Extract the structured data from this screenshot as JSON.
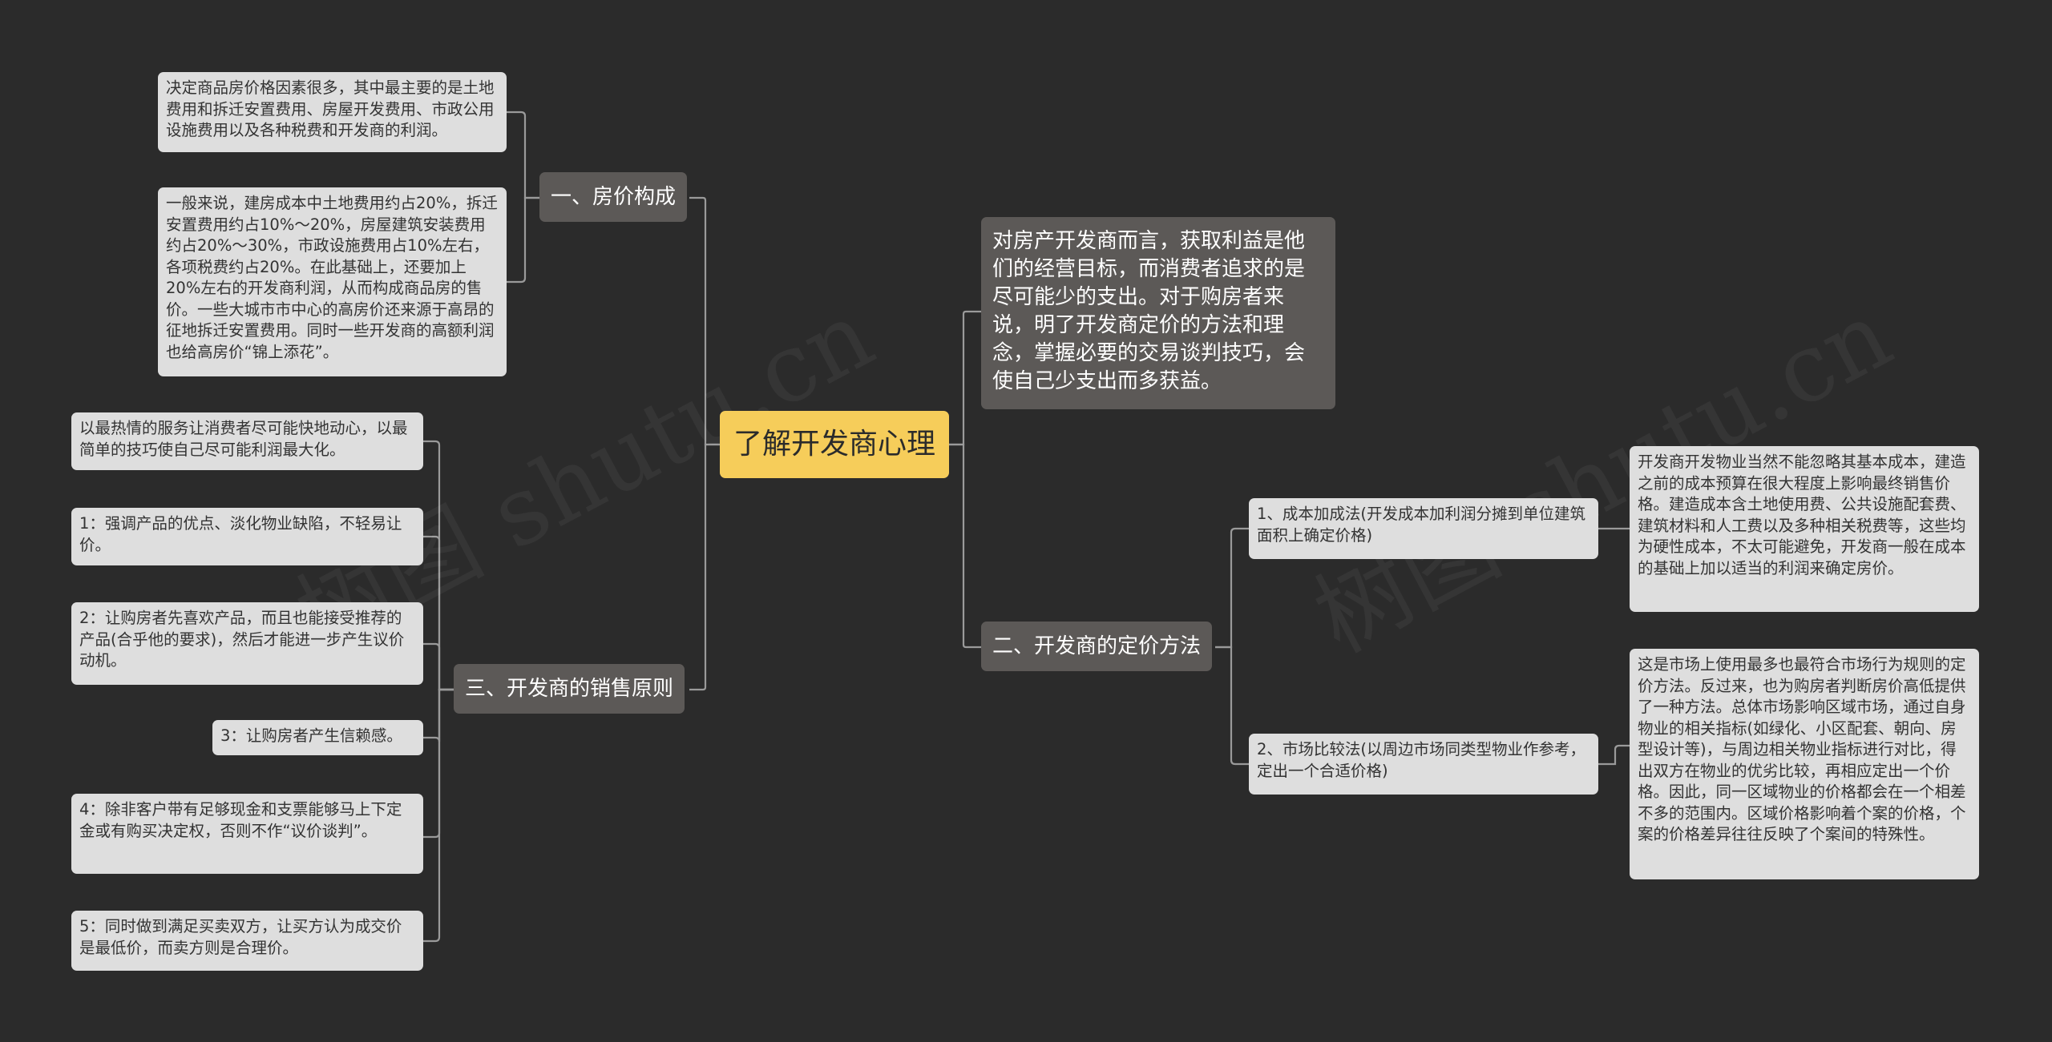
{
  "root": "了解开发商心理",
  "intro": "对房产开发商而言，获取利益是他们的经营目标，而消费者追求的是尽可能少的支出。对于购房者来说，明了开发商定价的方法和理念，掌握必要的交易谈判技巧，会使自己少支出而多获益。",
  "branch1": {
    "label": "一、房价构成",
    "leaves": [
      "决定商品房价格因素很多，其中最主要的是土地费用和拆迁安置费用、房屋开发费用、市政公用设施费用以及各种税费和开发商的利润。",
      "一般来说，建房成本中土地费用约占20%，拆迁安置费用约占10%～20%，房屋建筑安装费用约占20%～30%，市政设施费用占10%左右，各项税费约占20%。在此基础上，还要加上20%左右的开发商利润，从而构成商品房的售价。一些大城市市中心的高房价还来源于高昂的征地拆迁安置费用。同时一些开发商的高额利润也给高房价“锦上添花”。"
    ]
  },
  "branch2": {
    "label": "二、开发商的定价方法",
    "methods": [
      {
        "label": "1、成本加成法(开发成本加利润分摊到单位建筑面积上确定价格)",
        "detail": "开发商开发物业当然不能忽略其基本成本，建造之前的成本预算在很大程度上影响最终销售价格。建造成本含土地使用费、公共设施配套费、建筑材料和人工费以及多种相关税费等，这些均为硬性成本，不太可能避免，开发商一般在成本的基础上加以适当的利润来确定房价。"
      },
      {
        "label": "2、市场比较法(以周边市场同类型物业作参考，定出一个合适价格)",
        "detail": "这是市场上使用最多也最符合市场行为规则的定价方法。反过来，也为购房者判断房价高低提供了一种方法。总体市场影响区域市场，通过自身物业的相关指标(如绿化、小区配套、朝向、房型设计等)，与周边相关物业指标进行对比，得出双方在物业的优劣比较，再相应定出一个价格。因此，同一区域物业的价格都会在一个相差不多的范围内。区域价格影响着个案的价格，个案的价格差异往往反映了个案间的特殊性。"
      }
    ]
  },
  "branch3": {
    "label": "三、开发商的销售原则",
    "leaves": [
      "以最热情的服务让消费者尽可能快地动心，以最简单的技巧使自己尽可能利润最大化。",
      "1：强调产品的优点、淡化物业缺陷，不轻易让价。",
      "2：让购房者先喜欢产品，而且也能接受推荐的产品(合乎他的要求)，然后才能进一步产生议价动机。",
      "3：让购房者产生信赖感。",
      "4：除非客户带有足够现金和支票能够马上下定金或有购买决定权，否则不作“议价谈判”。",
      "5：同时做到满足买卖双方，让买方认为成交价是最低价，而卖方则是合理价。"
    ]
  },
  "watermark": "树图 shutu.cn",
  "colors": {
    "background": "#2b2b2b",
    "root": "#f6cd5a",
    "branch": "#5c5957",
    "leaf": "#dedede",
    "line": "#9a9a9a"
  }
}
